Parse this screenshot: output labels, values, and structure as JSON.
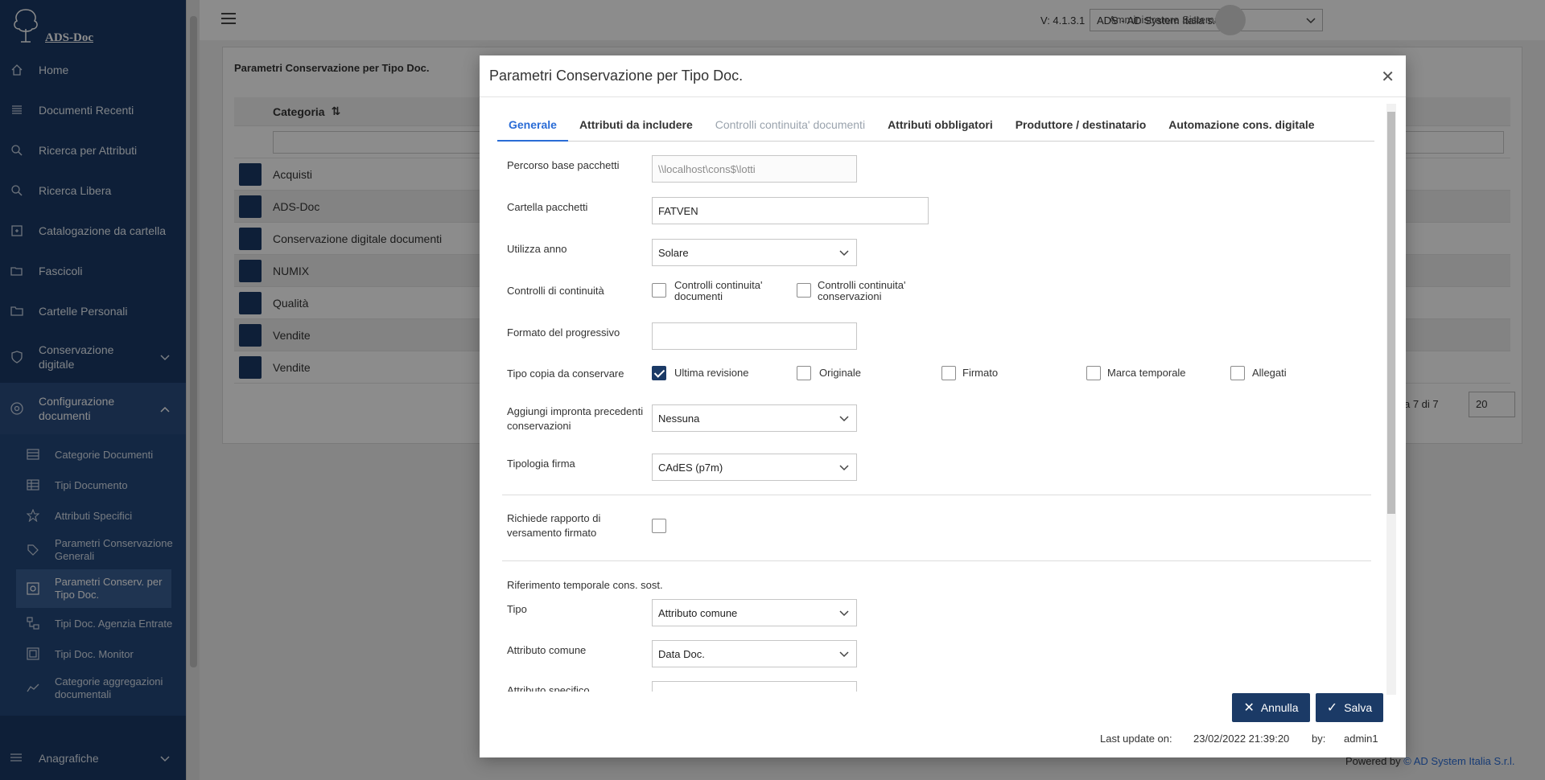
{
  "app": {
    "logo_text": "ADS-Doc",
    "version": "V: 4.1.3.1",
    "company": "ADS - AD System Italia s.r.l.",
    "user": "Amministratore Sistema"
  },
  "sidebar": {
    "items": [
      {
        "label": "Home",
        "icon": "home-icon"
      },
      {
        "label": "Documenti Recenti",
        "icon": "list-icon"
      },
      {
        "label": "Ricerca per Attributi",
        "icon": "search-icon"
      },
      {
        "label": "Ricerca Libera",
        "icon": "search-icon"
      },
      {
        "label": "Catalogazione da cartella",
        "icon": "import-icon"
      },
      {
        "label": "Fascicoli",
        "icon": "folder-open-icon"
      },
      {
        "label": "Cartelle Personali",
        "icon": "folder-icon"
      }
    ],
    "conservazione": "Conservazione digitale",
    "configurazione": "Configurazione documenti",
    "sub_items": [
      {
        "label": "Categorie Documenti"
      },
      {
        "label": "Tipi Documento"
      },
      {
        "label": "Attributi Specifici"
      },
      {
        "label": "Parametri Conservazione Generali"
      },
      {
        "label": "Parametri Conserv. per Tipo Doc."
      },
      {
        "label": "Tipi Doc. Agenzia Entrate"
      },
      {
        "label": "Tipi Doc. Monitor"
      },
      {
        "label": "Categorie aggregazioni documentali"
      }
    ],
    "anagrafiche": "Anagrafiche"
  },
  "background": {
    "panel_title": "Parametri Conservazione per Tipo Doc.",
    "column_header": "Categoria",
    "rows": [
      "Acquisti",
      "ADS-Doc",
      "Conservazione digitale documenti",
      "NUMIX",
      "Qualità",
      "Vendite",
      "Vendite"
    ],
    "pagination_text": "a 7 di 7",
    "page_size": "20",
    "powered_by": "Powered by",
    "powered_company": "© AD System Italia S.r.l."
  },
  "modal": {
    "title": "Parametri Conservazione per Tipo Doc.",
    "tabs": [
      {
        "label": "Generale"
      },
      {
        "label": "Attributi da includere"
      },
      {
        "label": "Controlli continuita' documenti"
      },
      {
        "label": "Attributi obbligatori"
      },
      {
        "label": "Produttore / destinatario"
      },
      {
        "label": "Automazione cons. digitale"
      }
    ],
    "fields": {
      "percorso_label": "Percorso base pacchetti",
      "percorso_value": "\\\\localhost\\cons$\\lotti",
      "cartella_label": "Cartella pacchetti",
      "cartella_value": "FATVEN",
      "anno_label": "Utilizza anno",
      "anno_value": "Solare",
      "controlli_label": "Controlli di continuità",
      "controlli_doc": "Controlli continuita' documenti",
      "controlli_cons": "Controlli continuita' conservazioni",
      "formato_label": "Formato del progressivo",
      "formato_value": "",
      "tipo_copia_label": "Tipo copia da conservare",
      "copia_options": [
        "Ultima revisione",
        "Originale",
        "Firmato",
        "Marca temporale",
        "Allegati"
      ],
      "impronta_label": "Aggiungi impronta precedenti conservazioni",
      "impronta_value": "Nessuna",
      "firma_label": "Tipologia firma",
      "firma_value": "CAdES (p7m)",
      "rapporto_label": "Richiede rapporto di versamento firmato",
      "riferimento_label": "Riferimento temporale cons. sost.",
      "tipo_label": "Tipo",
      "tipo_value": "Attributo comune",
      "attr_comune_label": "Attributo comune",
      "attr_comune_value": "Data Doc.",
      "attr_specifico_label": "Attributo specifico"
    },
    "buttons": {
      "cancel": "Annulla",
      "save": "Salva"
    },
    "last_update_label": "Last update on:",
    "last_update_value": "23/02/2022 21:39:20",
    "by_label": "by:",
    "by_value": "admin1"
  }
}
